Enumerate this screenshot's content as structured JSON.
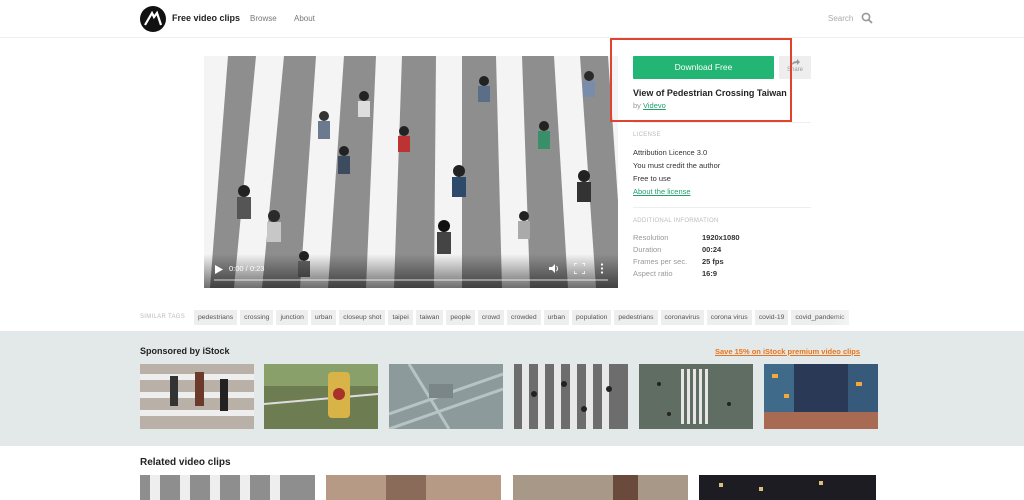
{
  "header": {
    "brand": "Free video clips",
    "nav": [
      "Browse",
      "About"
    ],
    "search_placeholder": "Search"
  },
  "player": {
    "time": "0:00 / 0:23",
    "progress_fraction": 0.0
  },
  "actions": {
    "download_label": "Download Free",
    "share_label": "Share"
  },
  "clip": {
    "title": "View of Pedestrian Crossing Taiwan",
    "by_prefix": "by",
    "author": "Videvo"
  },
  "license": {
    "heading": "LICENSE",
    "name": "Attribution Licence 3.0",
    "line1": "You must credit the author",
    "line2": "Free to use",
    "link": "About the license"
  },
  "info": {
    "heading": "ADDITIONAL INFORMATION",
    "rows": [
      {
        "key": "Resolution",
        "value": "1920x1080"
      },
      {
        "key": "Duration",
        "value": "00:24"
      },
      {
        "key": "Frames per sec.",
        "value": "25 fps"
      },
      {
        "key": "Aspect ratio",
        "value": "16:9"
      }
    ]
  },
  "tags": {
    "heading": "SIMILAR TAGS",
    "items": [
      "pedestrians",
      "crossing",
      "junction",
      "urban",
      "closeup shot",
      "taipei",
      "taiwan",
      "people",
      "crowd",
      "crowded",
      "urban",
      "population",
      "pedestrians",
      "coronavirus",
      "corona virus",
      "covid-19",
      "covid_pandemic"
    ]
  },
  "sponsored": {
    "title": "Sponsored by iStock",
    "link": "Save 15% on iStock premium video clips"
  },
  "related": {
    "title": "Related video clips"
  },
  "colors": {
    "accent": "#22b573",
    "highlight_box": "#e0432e",
    "sponsor_link": "#e8731a",
    "sponsored_bg": "#e3e9e9"
  }
}
